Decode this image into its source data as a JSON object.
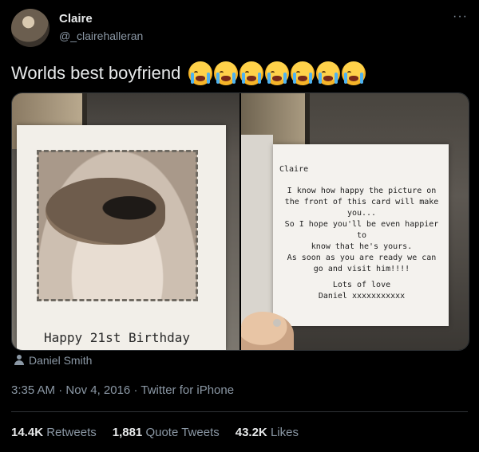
{
  "author": {
    "name": "Claire",
    "handle": "@_clairehalleran"
  },
  "tweet": {
    "text": "Worlds best boyfriend",
    "emoji_count": 7,
    "emoji_name": "loudly-crying-face"
  },
  "media": {
    "photo1": {
      "caption": "Happy 21st Birthday"
    },
    "photo2": {
      "to": "Claire",
      "message": "I know how happy the picture on\nthe front of this card will make\nyou...\nSo I hope you'll be even happier to\nknow that he's yours.\nAs soon as you are ready we can\ngo and visit him!!!!",
      "signoff": "Lots of love\nDaniel xxxxxxxxxxx"
    }
  },
  "tagged_user": "Daniel Smith",
  "meta": {
    "time": "3:35 AM",
    "sep1": "·",
    "date": "Nov 4, 2016",
    "sep2": "·",
    "source": "Twitter for iPhone"
  },
  "stats": {
    "retweets_count": "14.4K",
    "retweets_label": "Retweets",
    "quotes_count": "1,881",
    "quotes_label": "Quote Tweets",
    "likes_count": "43.2K",
    "likes_label": "Likes"
  },
  "more_label": "···"
}
